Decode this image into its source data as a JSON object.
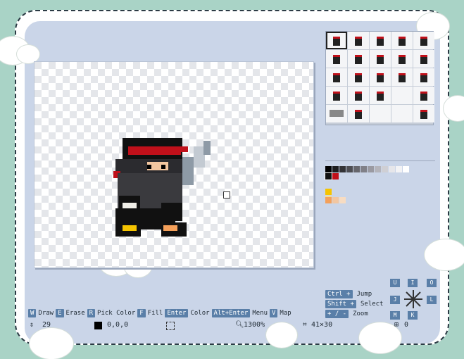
{
  "app": {
    "accent": "#5a7fa8",
    "panel_bg": "#cad5e8",
    "frame_bg": "#a9d3c6"
  },
  "shortcuts": [
    {
      "key": "W",
      "label": "Draw"
    },
    {
      "key": "E",
      "label": "Erase"
    },
    {
      "key": "R",
      "label": "Pick Color"
    },
    {
      "key": "F",
      "label": "Fill"
    },
    {
      "key": "Enter",
      "label": "Color"
    },
    {
      "key": "Alt+Enter",
      "label": "Menu"
    },
    {
      "key": "V",
      "label": "Map"
    }
  ],
  "right_shortcuts": [
    {
      "key": "Ctrl +",
      "label": "Jump"
    },
    {
      "key": "Shift +",
      "label": "Select"
    },
    {
      "key": "+ / -",
      "label": "Zoom"
    }
  ],
  "dpad": {
    "up": "U",
    "down": "K",
    "left": "J",
    "right": "L",
    "top_right": "O",
    "top_left": "I",
    "bottom_left": "M"
  },
  "status": {
    "tool_count": "29",
    "color_value": "0,0,0",
    "zoom": "1300%",
    "size": "41×30",
    "extra": "0"
  }
}
